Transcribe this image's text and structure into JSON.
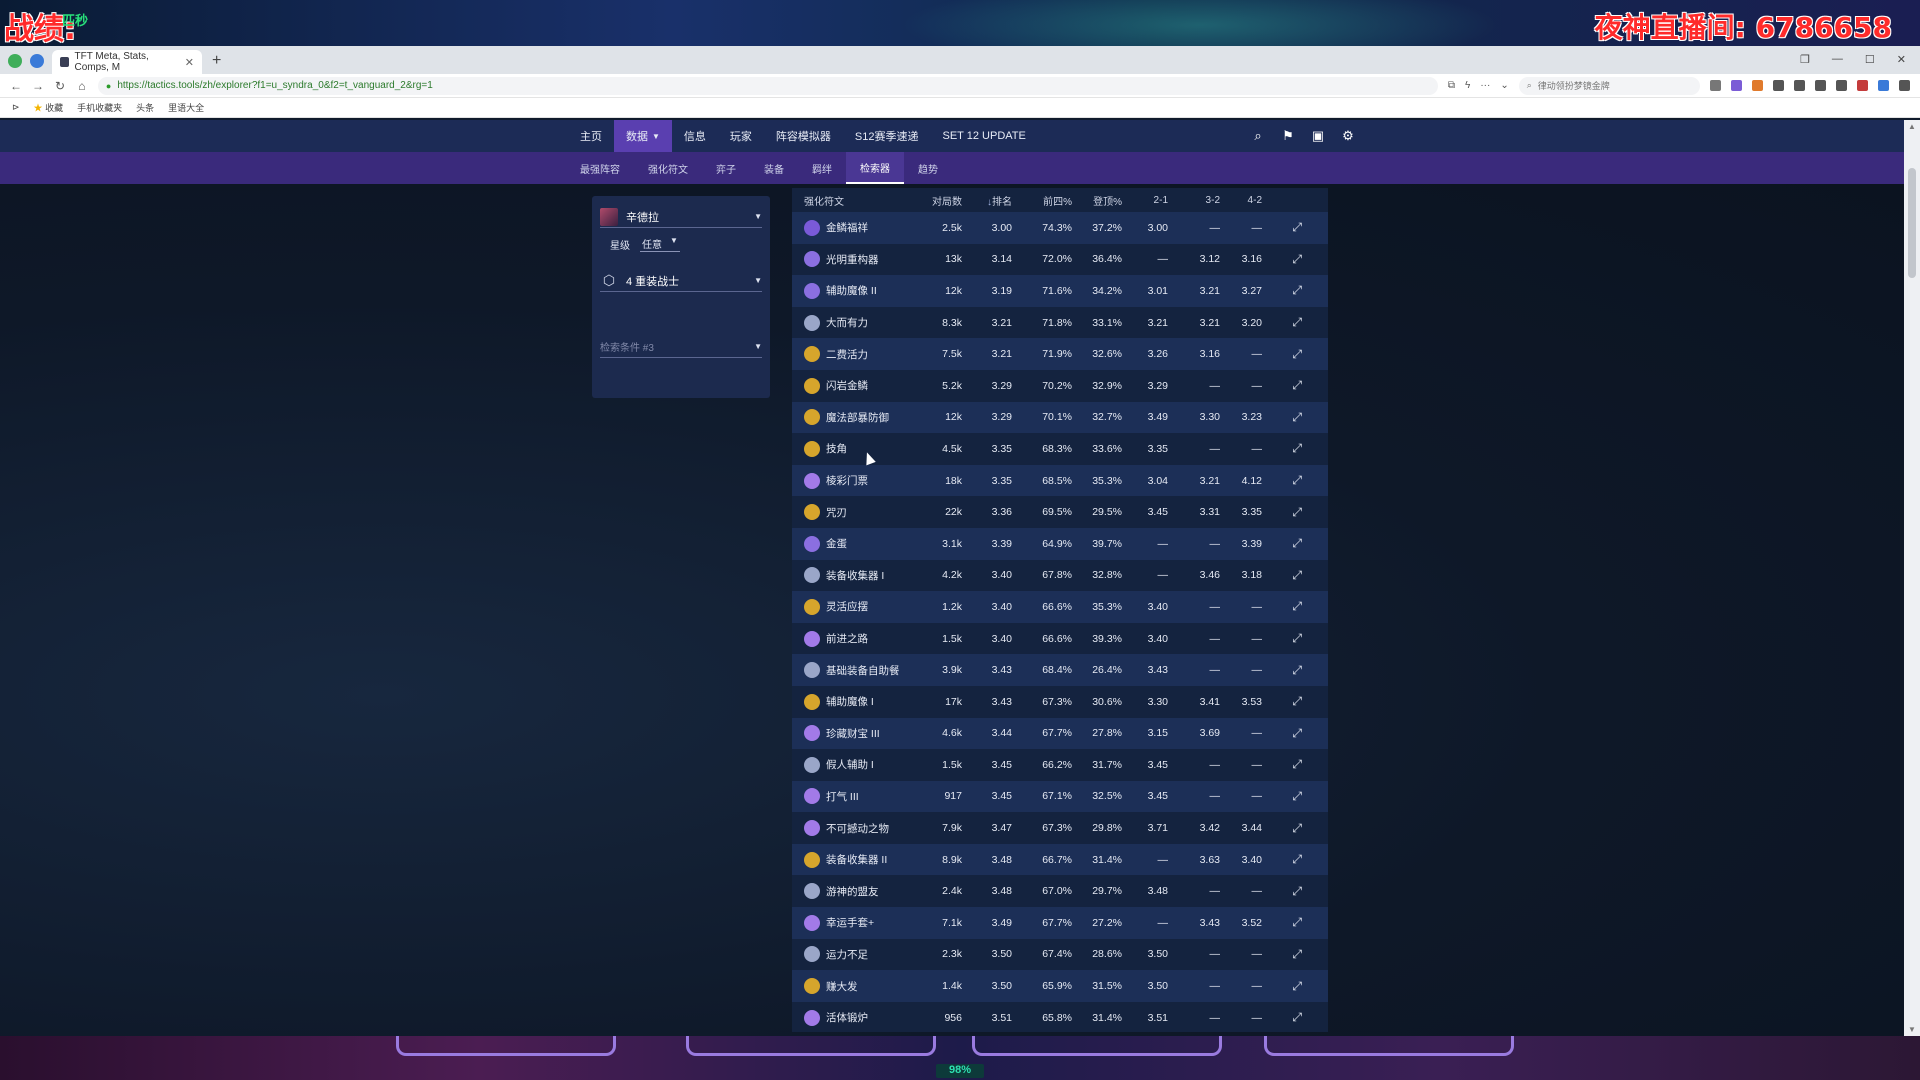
{
  "overlay": {
    "left_label": "战绩:",
    "left_sub": "匹秒",
    "right_label": "夜神直播间: 6786658"
  },
  "browser": {
    "tab_title": "TFT Meta, Stats, Comps, M",
    "url": "https://tactics.tools/zh/explorer?f1=u_syndra_0&f2=t_vanguard_2&rg=1",
    "search_placeholder": "律动领扮梦镜金牌",
    "bookmarks": [
      "收藏",
      "手机收藏夹",
      "头条",
      "里语大全"
    ]
  },
  "nav": {
    "items": [
      {
        "label": "主页"
      },
      {
        "label": "数据",
        "active": true,
        "dropdown": true
      },
      {
        "label": "信息"
      },
      {
        "label": "玩家"
      },
      {
        "label": "阵容模拟器"
      },
      {
        "label": "S12赛季速递"
      },
      {
        "label": "SET 12 UPDATE"
      }
    ],
    "icons": [
      "search-icon",
      "flag-icon",
      "discord-icon",
      "settings-icon"
    ]
  },
  "subnav": {
    "items": [
      {
        "label": "最强阵容"
      },
      {
        "label": "强化符文"
      },
      {
        "label": "弈子"
      },
      {
        "label": "装备"
      },
      {
        "label": "羁绊"
      },
      {
        "label": "检索器",
        "active": true
      },
      {
        "label": "趋势"
      }
    ]
  },
  "filters": {
    "unit": "辛德拉",
    "star_label": "星级",
    "star_value": "任意",
    "trait": "4 重装战士",
    "placeholder": "检索条件 #3"
  },
  "table": {
    "headers": {
      "name": "强化符文",
      "games": "对局数",
      "avg": "排名",
      "top4": "前四%",
      "win": "登顶%",
      "s1": "2-1",
      "s2": "3-2",
      "s3": "4-2"
    },
    "rows": [
      {
        "name": "金鳞福祥",
        "games": "2.5k",
        "avg": "3.00",
        "top4": "74.3%",
        "win": "37.2%",
        "s1": "3.00",
        "s2": "—",
        "s3": "—",
        "color": "#7a5ad8"
      },
      {
        "name": "光明重构器",
        "games": "13k",
        "avg": "3.14",
        "top4": "72.0%",
        "win": "36.4%",
        "s1": "—",
        "s2": "3.12",
        "s3": "3.16",
        "color": "#8b6fe0"
      },
      {
        "name": "辅助魔像 II",
        "games": "12k",
        "avg": "3.19",
        "top4": "71.6%",
        "win": "34.2%",
        "s1": "3.01",
        "s2": "3.21",
        "s3": "3.27",
        "color": "#8b6fe0"
      },
      {
        "name": "大而有力",
        "games": "8.3k",
        "avg": "3.21",
        "top4": "71.8%",
        "win": "33.1%",
        "s1": "3.21",
        "s2": "3.21",
        "s3": "3.20",
        "color": "#9aa6c8"
      },
      {
        "name": "二费活力",
        "games": "7.5k",
        "avg": "3.21",
        "top4": "71.9%",
        "win": "32.6%",
        "s1": "3.26",
        "s2": "3.16",
        "s3": "—",
        "color": "#d6a52c"
      },
      {
        "name": "闪岩金鳞",
        "games": "5.2k",
        "avg": "3.29",
        "top4": "70.2%",
        "win": "32.9%",
        "s1": "3.29",
        "s2": "—",
        "s3": "—",
        "color": "#d6a52c"
      },
      {
        "name": "魔法部暴防御",
        "games": "12k",
        "avg": "3.29",
        "top4": "70.1%",
        "win": "32.7%",
        "s1": "3.49",
        "s2": "3.30",
        "s3": "3.23",
        "color": "#d6a52c"
      },
      {
        "name": "技角",
        "games": "4.5k",
        "avg": "3.35",
        "top4": "68.3%",
        "win": "33.6%",
        "s1": "3.35",
        "s2": "—",
        "s3": "—",
        "color": "#d6a52c"
      },
      {
        "name": "棱彩门票",
        "games": "18k",
        "avg": "3.35",
        "top4": "68.5%",
        "win": "35.3%",
        "s1": "3.04",
        "s2": "3.21",
        "s3": "4.12",
        "color": "#a27ae8"
      },
      {
        "name": "咒刃",
        "games": "22k",
        "avg": "3.36",
        "top4": "69.5%",
        "win": "29.5%",
        "s1": "3.45",
        "s2": "3.31",
        "s3": "3.35",
        "color": "#d6a52c"
      },
      {
        "name": "金蛋",
        "games": "3.1k",
        "avg": "3.39",
        "top4": "64.9%",
        "win": "39.7%",
        "s1": "—",
        "s2": "—",
        "s3": "3.39",
        "color": "#8b6fe0"
      },
      {
        "name": "装备收集器 I",
        "games": "4.2k",
        "avg": "3.40",
        "top4": "67.8%",
        "win": "32.8%",
        "s1": "—",
        "s2": "3.46",
        "s3": "3.18",
        "color": "#9aa6c8"
      },
      {
        "name": "灵活应摆",
        "games": "1.2k",
        "avg": "3.40",
        "top4": "66.6%",
        "win": "35.3%",
        "s1": "3.40",
        "s2": "—",
        "s3": "—",
        "color": "#d6a52c"
      },
      {
        "name": "前进之路",
        "games": "1.5k",
        "avg": "3.40",
        "top4": "66.6%",
        "win": "39.3%",
        "s1": "3.40",
        "s2": "—",
        "s3": "—",
        "color": "#a27ae8"
      },
      {
        "name": "基础装备自助餐",
        "games": "3.9k",
        "avg": "3.43",
        "top4": "68.4%",
        "win": "26.4%",
        "s1": "3.43",
        "s2": "—",
        "s3": "—",
        "color": "#9aa6c8"
      },
      {
        "name": "辅助魔像 I",
        "games": "17k",
        "avg": "3.43",
        "top4": "67.3%",
        "win": "30.6%",
        "s1": "3.30",
        "s2": "3.41",
        "s3": "3.53",
        "color": "#d6a52c"
      },
      {
        "name": "珍藏财宝 III",
        "games": "4.6k",
        "avg": "3.44",
        "top4": "67.7%",
        "win": "27.8%",
        "s1": "3.15",
        "s2": "3.69",
        "s3": "—",
        "color": "#a27ae8"
      },
      {
        "name": "假人辅助 I",
        "games": "1.5k",
        "avg": "3.45",
        "top4": "66.2%",
        "win": "31.7%",
        "s1": "3.45",
        "s2": "—",
        "s3": "—",
        "color": "#9aa6c8"
      },
      {
        "name": "打气 III",
        "games": "917",
        "avg": "3.45",
        "top4": "67.1%",
        "win": "32.5%",
        "s1": "3.45",
        "s2": "—",
        "s3": "—",
        "color": "#a27ae8"
      },
      {
        "name": "不可撼动之物",
        "games": "7.9k",
        "avg": "3.47",
        "top4": "67.3%",
        "win": "29.8%",
        "s1": "3.71",
        "s2": "3.42",
        "s3": "3.44",
        "color": "#a27ae8"
      },
      {
        "name": "装备收集器 II",
        "games": "8.9k",
        "avg": "3.48",
        "top4": "66.7%",
        "win": "31.4%",
        "s1": "—",
        "s2": "3.63",
        "s3": "3.40",
        "color": "#d6a52c"
      },
      {
        "name": "游神的盟友",
        "games": "2.4k",
        "avg": "3.48",
        "top4": "67.0%",
        "win": "29.7%",
        "s1": "3.48",
        "s2": "—",
        "s3": "—",
        "color": "#9aa6c8"
      },
      {
        "name": "幸运手套+",
        "games": "7.1k",
        "avg": "3.49",
        "top4": "67.7%",
        "win": "27.2%",
        "s1": "—",
        "s2": "3.43",
        "s3": "3.52",
        "color": "#a27ae8"
      },
      {
        "name": "运力不足",
        "games": "2.3k",
        "avg": "3.50",
        "top4": "67.4%",
        "win": "28.6%",
        "s1": "3.50",
        "s2": "—",
        "s3": "—",
        "color": "#9aa6c8"
      },
      {
        "name": "赚大发",
        "games": "1.4k",
        "avg": "3.50",
        "top4": "65.9%",
        "win": "31.5%",
        "s1": "3.50",
        "s2": "—",
        "s3": "—",
        "color": "#d6a52c"
      },
      {
        "name": "活体锻炉",
        "games": "956",
        "avg": "3.51",
        "top4": "65.8%",
        "win": "31.4%",
        "s1": "3.51",
        "s2": "—",
        "s3": "—",
        "color": "#a27ae8"
      }
    ]
  },
  "game_strip": {
    "percent": "98%"
  }
}
